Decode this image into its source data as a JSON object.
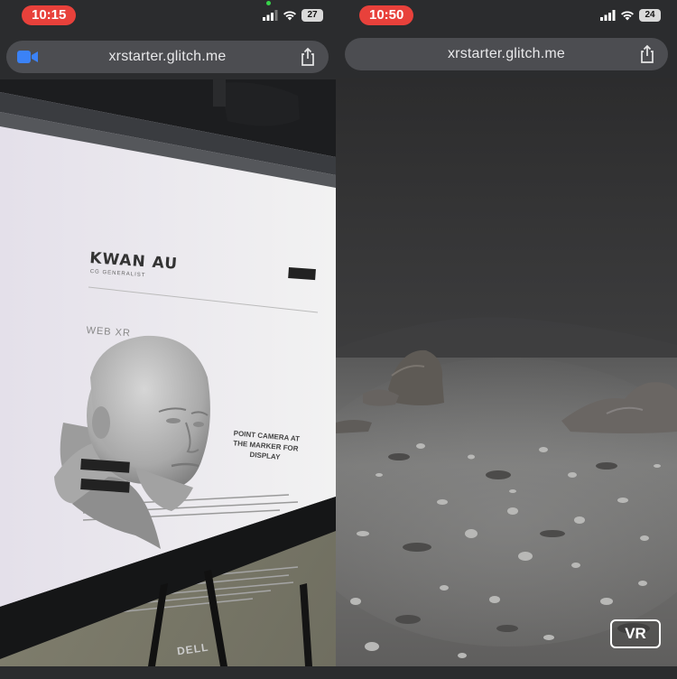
{
  "left_phone": {
    "status": {
      "time": "10:15",
      "battery": "27"
    },
    "browser": {
      "url": "xrstarter.glitch.me"
    },
    "screen_content": {
      "site_name": "KWAN AU",
      "site_subtitle": "CG GENERALIST",
      "section_heading": "WEB XR",
      "marker_prompt": "POINT CAMERA AT THE MARKER FOR DISPLAY",
      "monitor_brand": "DELL"
    }
  },
  "right_phone": {
    "status": {
      "time": "10:50",
      "battery": "24"
    },
    "browser": {
      "url": "xrstarter.glitch.me"
    },
    "vr_button": "VR"
  },
  "colors": {
    "time_pill": "#e8413b",
    "browser_chrome": "#2b2c2e",
    "url_bar": "#4c4d51",
    "video_icon": "#3b82f6"
  },
  "icons": [
    "video-camera-icon",
    "share-icon",
    "signal-icon",
    "wifi-icon",
    "battery-icon"
  ]
}
